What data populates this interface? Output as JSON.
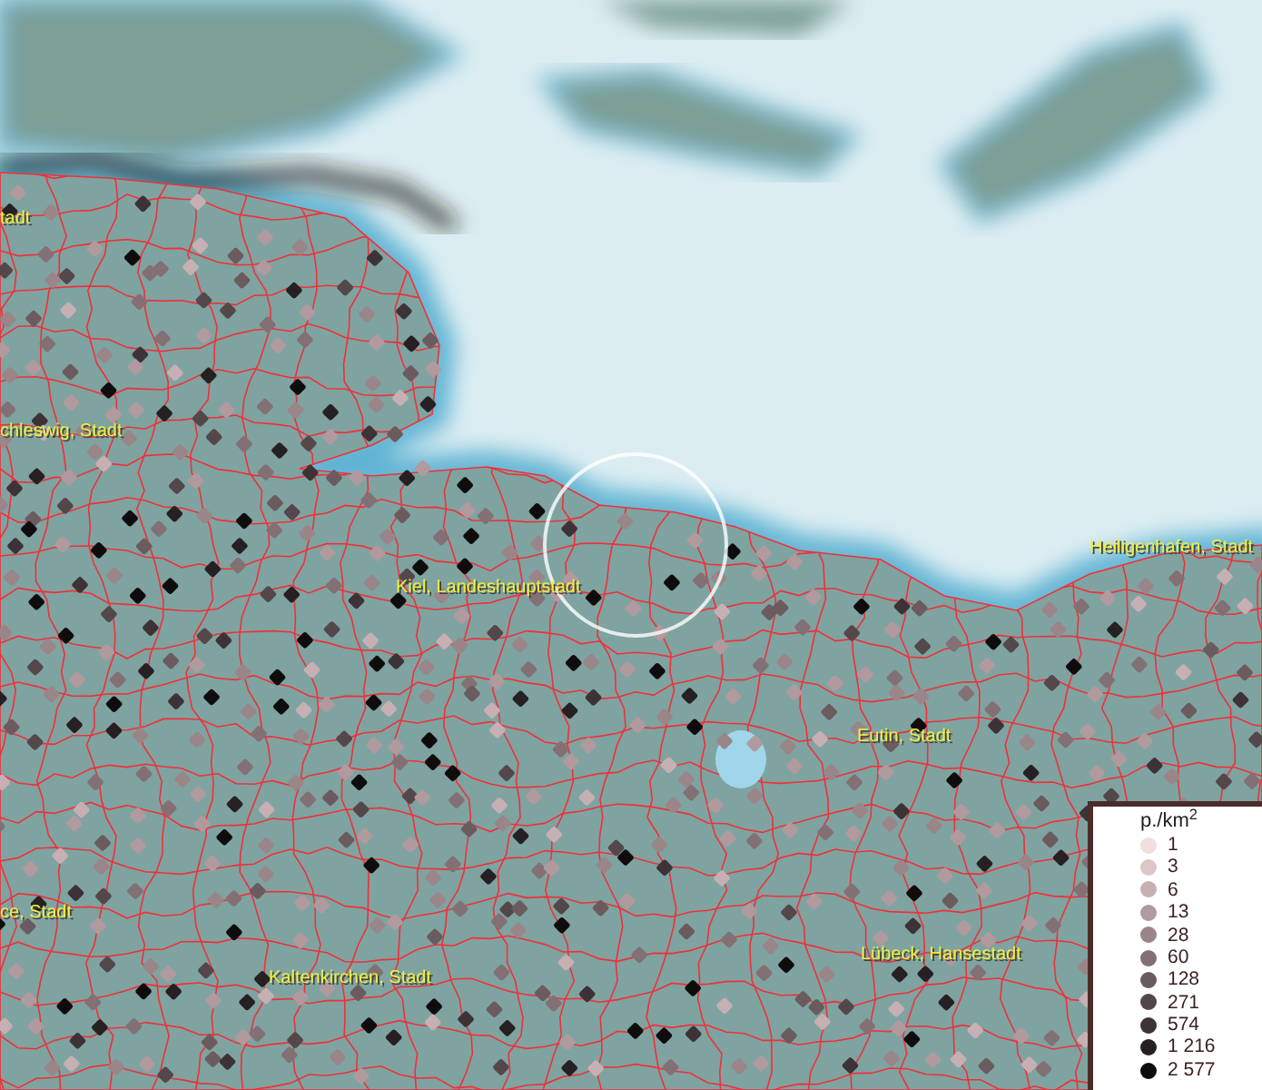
{
  "place_labels": [
    {
      "text": "tadt"
    },
    {
      "text": "chleswig, Stadt"
    },
    {
      "text": "Kiel, Landeshauptstadt"
    },
    {
      "text": "Heiligenhafen, Stadt"
    },
    {
      "text": "Eutin, Stadt"
    },
    {
      "text": "ce, Stadt"
    },
    {
      "text": "Kaltenkirchen, Stadt"
    },
    {
      "text": "Lübeck, Hansestadt"
    }
  ],
  "legend": {
    "title": "p./km$^{2}$",
    "items": [
      {
        "label": "1",
        "color": "#f2dede"
      },
      {
        "label": "3",
        "color": "#dcc6c8"
      },
      {
        "label": "6",
        "color": "#c6b0b3"
      },
      {
        "label": "13",
        "color": "#b09a9e"
      },
      {
        "label": "28",
        "color": "#9a8589"
      },
      {
        "label": "60",
        "color": "#837074"
      },
      {
        "label": "128",
        "color": "#6b5b5f"
      },
      {
        "label": "271",
        "color": "#54474a"
      },
      {
        "label": "574",
        "color": "#3d3336"
      },
      {
        "label": "1 216",
        "color": "#262022"
      },
      {
        "label": "2 577",
        "color": "#0f0c0d"
      }
    ]
  }
}
